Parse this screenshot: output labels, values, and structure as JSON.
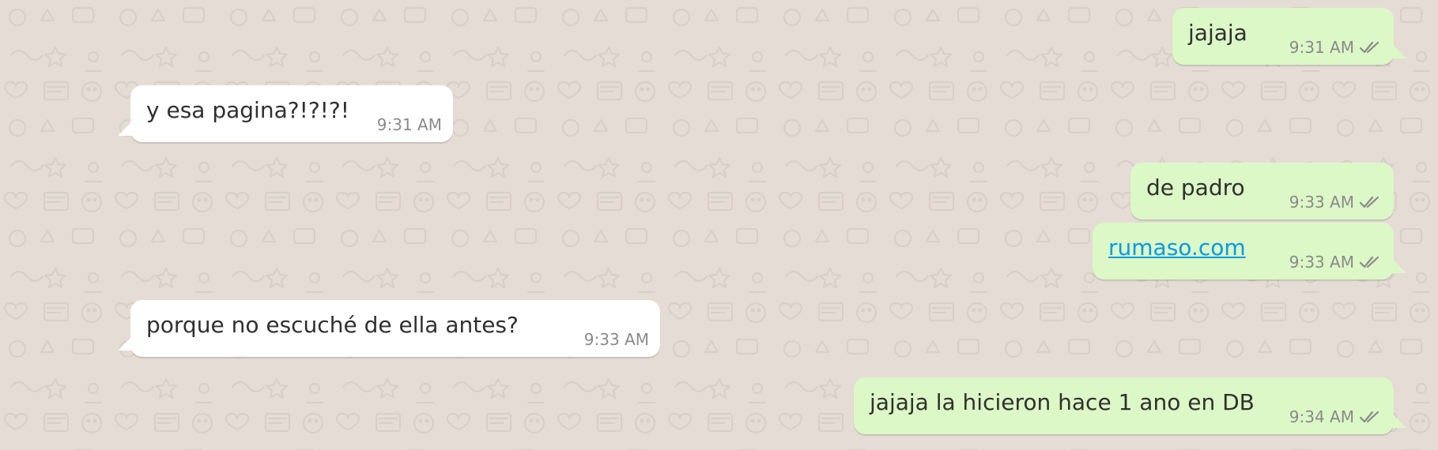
{
  "colors": {
    "background": "#e5ddd5",
    "incoming_bubble": "#ffffff",
    "outgoing_bubble": "#dcf8c6",
    "timestamp": "#8a8a8a",
    "read_ticks": "#8a8a8a",
    "link": "#039be5"
  },
  "messages": [
    {
      "direction": "outgoing",
      "text": "jajaja",
      "time": "9:31 AM",
      "status_icon": "double-check-icon"
    },
    {
      "direction": "incoming",
      "text": "y esa pagina?!?!?!",
      "time": "9:31 AM"
    },
    {
      "direction": "outgoing",
      "text": "de padro",
      "time": "9:33 AM",
      "status_icon": "double-check-icon"
    },
    {
      "direction": "outgoing",
      "text": "rumaso.com",
      "time": "9:33 AM",
      "status_icon": "double-check-icon",
      "is_link": true
    },
    {
      "direction": "incoming",
      "text": "porque no escuché de ella antes?",
      "time": "9:33 AM"
    },
    {
      "direction": "outgoing",
      "text": "jajaja la hicieron hace 1 ano en DB",
      "time": "9:34 AM",
      "status_icon": "double-check-icon"
    }
  ]
}
